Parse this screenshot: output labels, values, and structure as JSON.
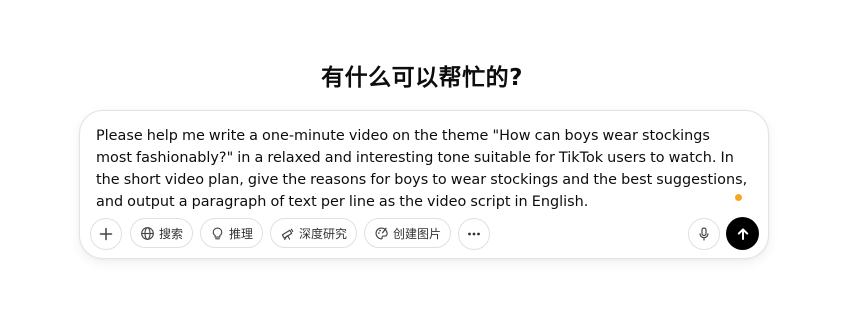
{
  "main": {
    "heading": "有什么可以帮忙的?"
  },
  "composer": {
    "prompt_text": "Please help me write a one-minute video on the theme \"How can boys wear stockings most fashionably?\" in a relaxed and interesting tone suitable for TikTok users to watch. In the short video plan, give the reasons for boys to wear stockings and the best suggestions, and output a paragraph of text per line as the video script in English.",
    "status_dot_color": "#f5a623",
    "toolbar": {
      "add_icon": "plus-icon",
      "search_label": "搜索",
      "search_icon": "globe-icon",
      "reason_label": "推理",
      "reason_icon": "lightbulb-icon",
      "deep_research_label": "深度研究",
      "deep_research_icon": "telescope-icon",
      "create_image_label": "创建图片",
      "create_image_icon": "palette-icon",
      "more_icon": "ellipsis-icon",
      "mic_icon": "microphone-icon",
      "send_icon": "arrow-up-icon"
    }
  }
}
